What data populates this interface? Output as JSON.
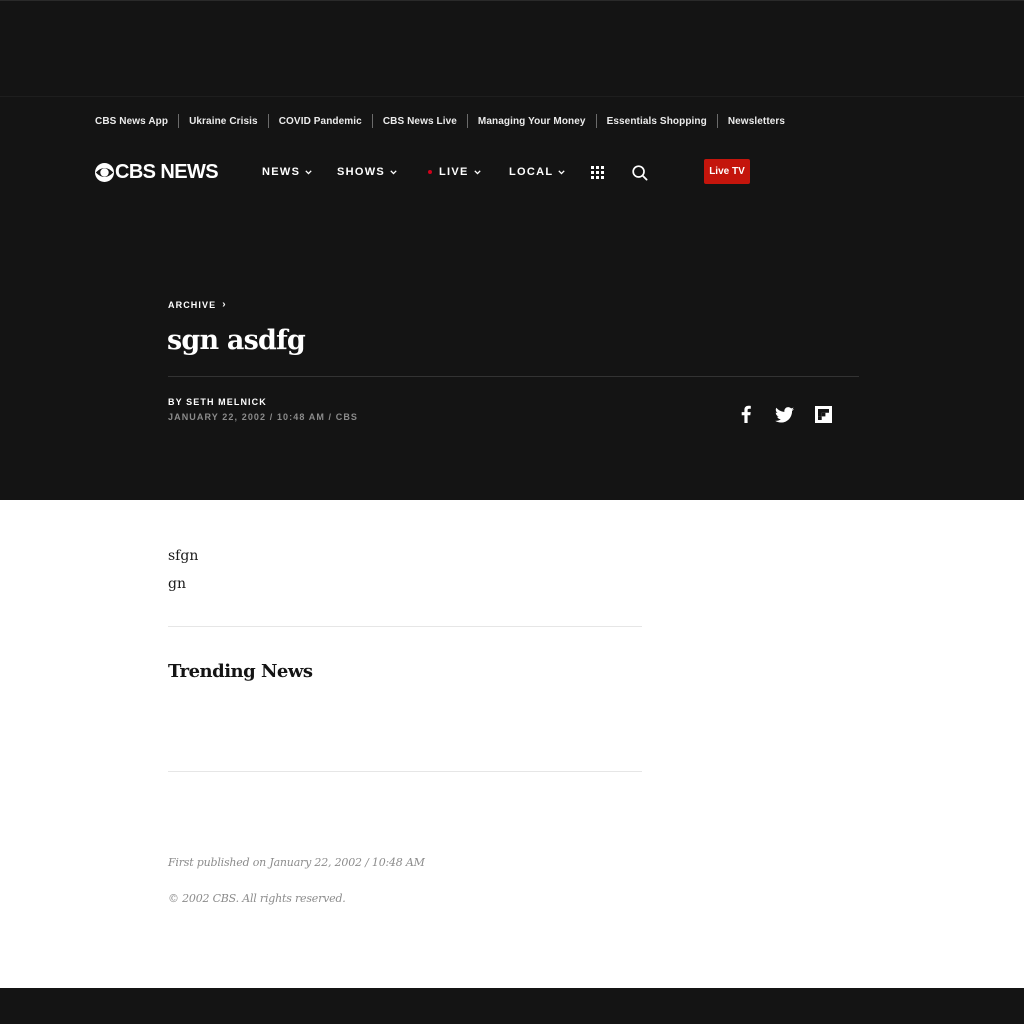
{
  "top_links": [
    "CBS News App",
    "Ukraine Crisis",
    "COVID Pandemic",
    "CBS News Live",
    "Managing Your Money",
    "Essentials Shopping",
    "Newsletters"
  ],
  "brand": {
    "logo_text": "CBSNEWS"
  },
  "nav": {
    "news": "NEWS",
    "shows": "SHOWS",
    "live": "LIVE",
    "local": "LOCAL",
    "live_tv": "Live TV"
  },
  "article": {
    "breadcrumb": "ARCHIVE",
    "breadcrumb_arrow": "›",
    "headline": "sgn asdfg",
    "byline_prefix": "BY",
    "author": "SETH MELNICK",
    "dateline": "JANUARY 22, 2002 / 10:48 AM / CBS",
    "body": [
      "sfgn",
      "gn"
    ]
  },
  "trending": {
    "title": "Trending News"
  },
  "footer_meta": {
    "first_published": "First published on January 22, 2002 / 10:48 AM",
    "copyright": "© 2002 CBS. All rights reserved."
  },
  "icons": {
    "chevron": "chevron-down-icon",
    "grid": "grid-icon",
    "search": "search-icon",
    "facebook": "facebook-icon",
    "twitter": "twitter-icon",
    "flipboard": "flipboard-icon"
  },
  "colors": {
    "header_bg": "#141414",
    "live_tv_bg": "#c4150c",
    "live_dot": "#d0021b",
    "meta_gray": "#8b8b8b"
  }
}
